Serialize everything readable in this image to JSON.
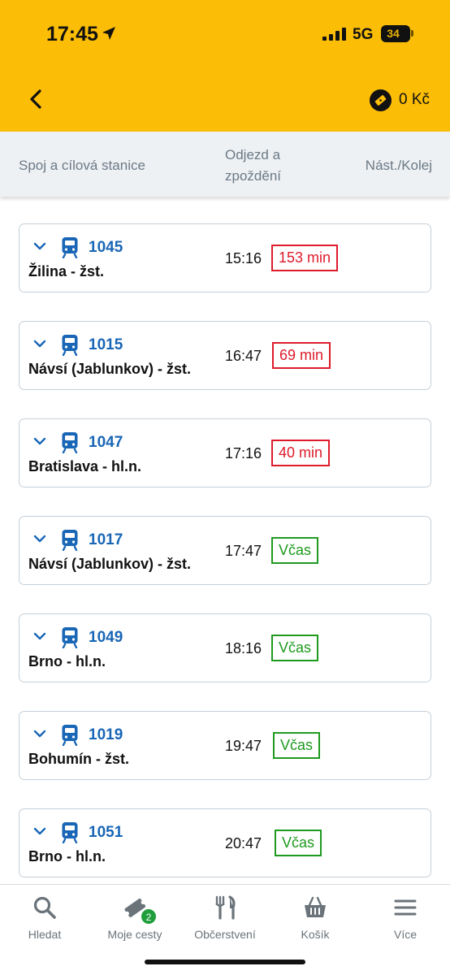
{
  "status_bar": {
    "time": "17:45",
    "network": "5G",
    "battery": "34"
  },
  "header": {
    "wallet_amount": "0 Kč"
  },
  "columns": {
    "connection": "Spoj a cílová stanice",
    "departure": "Odjezd a zpoždění",
    "platform": "Nást./Kolej"
  },
  "trains": [
    {
      "number": "1045",
      "destination": "Žilina - žst.",
      "departure": "15:16",
      "delay": "153 min",
      "status": "late"
    },
    {
      "number": "1015",
      "destination": "Návsí (Jablunkov) - žst.",
      "departure": "16:47",
      "delay": "69 min",
      "status": "late"
    },
    {
      "number": "1047",
      "destination": "Bratislava - hl.n.",
      "departure": "17:16",
      "delay": "40 min",
      "status": "late"
    },
    {
      "number": "1017",
      "destination": "Návsí (Jablunkov) - žst.",
      "departure": "17:47",
      "delay": "Včas",
      "status": "ontime"
    },
    {
      "number": "1049",
      "destination": "Brno - hl.n.",
      "departure": "18:16",
      "delay": "Včas",
      "status": "ontime"
    },
    {
      "number": "1019",
      "destination": "Bohumín - žst.",
      "departure": "19:47",
      "delay": "Včas",
      "status": "ontime"
    },
    {
      "number": "1051",
      "destination": "Brno - hl.n.",
      "departure": "20:47",
      "delay": "Včas",
      "status": "ontime"
    }
  ],
  "colors": {
    "accent": "#fbbd05",
    "link": "#1966b6",
    "late": "#dd1b2a",
    "ontime": "#1e9a1e"
  },
  "tabs": [
    {
      "label": "Hledat",
      "icon": "search-icon"
    },
    {
      "label": "Moje cesty",
      "icon": "ticket-icon",
      "badge": "2"
    },
    {
      "label": "Občerstvení",
      "icon": "fork-knife-icon"
    },
    {
      "label": "Košík",
      "icon": "basket-icon"
    },
    {
      "label": "Více",
      "icon": "menu-icon"
    }
  ]
}
